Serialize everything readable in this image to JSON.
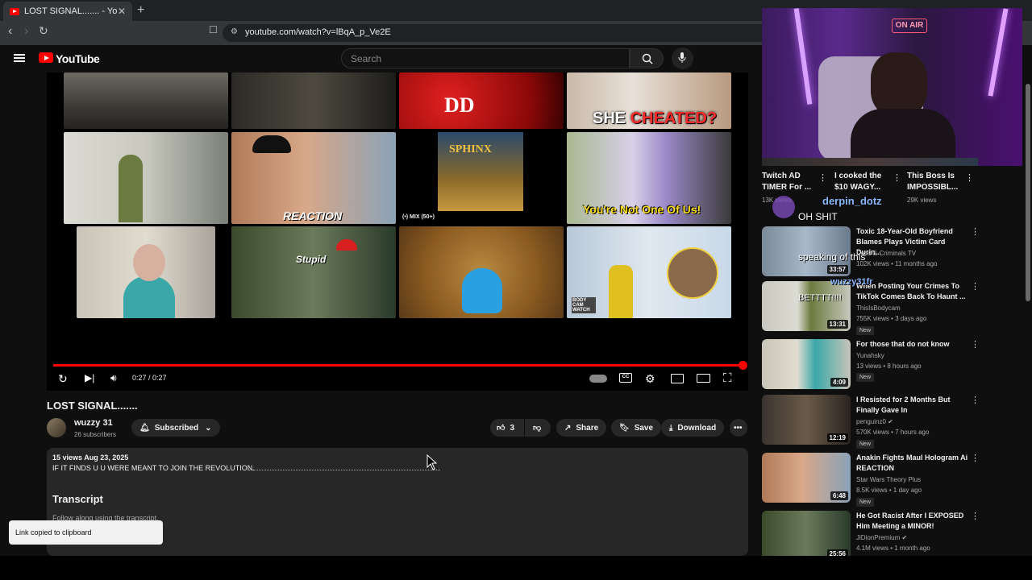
{
  "browser": {
    "tab_title": "LOST SIGNAL....... - YouTube",
    "url": "youtube.com/watch?v=lBqA_p_Ve2E"
  },
  "youtube": {
    "logo_text": "YouTube",
    "search_placeholder": "Search"
  },
  "player": {
    "thumb_labels": {
      "she_cheated_1": "SHE ",
      "she_cheated_2": "CHEATED?",
      "reaction": "REACTION",
      "sphinx": "SPHINX",
      "mix": "(•) MIX (50+)",
      "not_one_of_us": "You're Not One Of Us!",
      "stupid": "Stupid",
      "body_cam": "BODY CAM WATCH"
    },
    "time": "0:27 / 0:27",
    "progress": 1.0,
    "controls": [
      "replay-icon",
      "next-icon",
      "volume-icon",
      "autoplay-toggle",
      "captions-icon",
      "settings-icon",
      "miniplayer-icon",
      "theater-icon",
      "fullscreen-icon"
    ]
  },
  "video": {
    "title": "LOST SIGNAL.......",
    "channel": "wuzzy 31",
    "subscribers": "26 subscribers",
    "subscribed_label": "Subscribed",
    "like_count": "3",
    "share_label": "Share",
    "save_label": "Save",
    "download_label": "Download",
    "views_date": "15 views  Aug 23, 2025",
    "description": "IF IT FINDS U U WERE MEANT TO JOIN THE REVOLUTION.",
    "transcript_heading": "Transcript",
    "transcript_sub": "Follow along using the transcript."
  },
  "toast": "Link copied to clipboard",
  "stream_overlay": {
    "on_air": "ON AIR",
    "chat_name_1": "derpin_dotz",
    "chat_msg_1": "OH SHIT",
    "chat_msg_2": "speaking of this",
    "chat_name_3": "wuzzy31fr",
    "chat_msg_3": "BETTTT!!!!"
  },
  "sidebar": {
    "top_row": [
      {
        "title": "Twitch AD TIMER For ...",
        "meta": "13K views"
      },
      {
        "title": "I cooked the $10 WAGY...",
        "meta": ""
      },
      {
        "title": "This Boss Is IMPOSSIBL...",
        "meta": "29K views"
      }
    ],
    "items": [
      {
        "title": "Toxic 18-Year-Old Boyfriend Blames Plays Victim Card Durin...",
        "channel": "Cops & Criminals TV",
        "meta": "102K views • 11 months ago",
        "duration": "33:57",
        "new": ""
      },
      {
        "title": "When Posting Your Crimes To TikTok Comes Back To Haunt ...",
        "channel": "ThisIsBodycam",
        "meta": "755K views • 3 days ago",
        "duration": "13:31",
        "new": "New"
      },
      {
        "title": "For those that do not know",
        "channel": "Yunahsky",
        "meta": "13 views • 8 hours ago",
        "duration": "4:09",
        "new": "New"
      },
      {
        "title": "I Resisted for 2 Months But Finally Gave In",
        "channel": "penguinz0 ✔",
        "meta": "570K views • 7 hours ago",
        "duration": "12:19",
        "new": "New"
      },
      {
        "title": "Anakin Fights Maul Hologram Ai REACTION",
        "channel": "Star Wars Theory Plus",
        "meta": "8.5K views • 1 day ago",
        "duration": "6:48",
        "new": "New"
      },
      {
        "title": "He Got Racist After I EXPOSED Him Meeting a MINOR!",
        "channel": "JiDionPremium ✔",
        "meta": "4.1M views • 1 month ago",
        "duration": "25:56",
        "new": ""
      }
    ]
  },
  "colors": {
    "accent": "#ff0000",
    "bg": "#0f0f0f",
    "chip": "#272727"
  }
}
